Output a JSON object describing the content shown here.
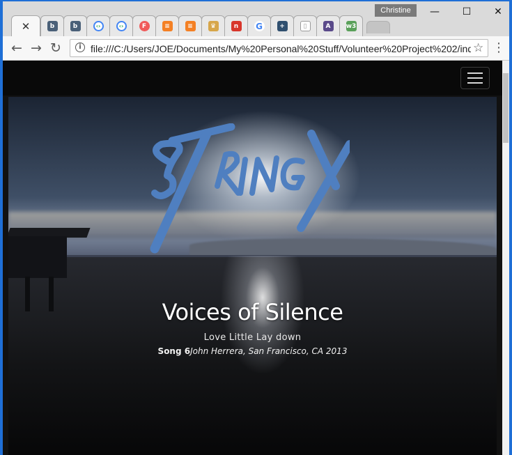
{
  "browser": {
    "profile_name": "Christine",
    "url": "file:///C:/Users/JOE/Documents/My%20Personal%20Stuff/Volunteer%20Project%202/ind",
    "tabs": [
      {
        "icon": "close-icon",
        "active": true,
        "glyph": "✕"
      },
      {
        "icon": "bitly-icon",
        "glyph": "b",
        "color": "#4a6078"
      },
      {
        "icon": "bitly-icon",
        "glyph": "b",
        "color": "#4a6078"
      },
      {
        "icon": "code-icon",
        "glyph": "‹›",
        "color": "#ffffff"
      },
      {
        "icon": "code-icon",
        "glyph": "‹›",
        "color": "#ffffff"
      },
      {
        "icon": "f-logo-icon",
        "glyph": "F",
        "color": "#f05a5a"
      },
      {
        "icon": "stackoverflow-icon",
        "glyph": "≡",
        "color": "#f48024"
      },
      {
        "icon": "stackoverflow-icon",
        "glyph": "≡",
        "color": "#f48024"
      },
      {
        "icon": "lion-icon",
        "glyph": "♛",
        "color": "#d7a64a"
      },
      {
        "icon": "n-logo-icon",
        "glyph": "n",
        "color": "#d8362b"
      },
      {
        "icon": "google-icon",
        "glyph": "G",
        "color": "#4285f4"
      },
      {
        "icon": "plus-icon",
        "glyph": "+",
        "color": "#2f4f6f"
      },
      {
        "icon": "page-icon",
        "glyph": "▯",
        "color": "#9a9a9a"
      },
      {
        "icon": "a-logo-icon",
        "glyph": "A",
        "color": "#5a4a8a"
      },
      {
        "icon": "w3-icon",
        "glyph": "w3",
        "color": "#5aa05a"
      }
    ]
  },
  "site": {
    "logo_text": "STRINGX",
    "title": "Voices of Silence",
    "subtitle": "Love Little Lay down",
    "meta_song": "Song 6",
    "meta_detail": "John Herrera, San Francisco, CA 2013"
  },
  "colors": {
    "titlebar": "#1f6fd6",
    "logo_blue": "#4f7fc0"
  }
}
